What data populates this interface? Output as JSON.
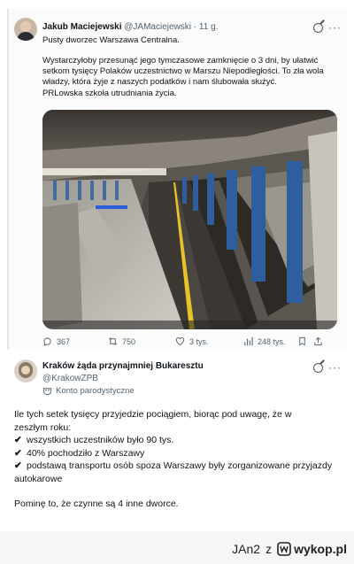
{
  "quoted_post": {
    "author_name": "Jakub Maciejewski",
    "author_handle": "@JAMaciejewski",
    "time": "· 11 g.",
    "headline": "Pusty dworzec Warszawa Centralna.",
    "body_lines": [
      "Wystarczyłoby przesunąć jego tymczasowe zamknięcie o 3 dni, by ułatwić",
      "setkom tysięcy Polaków uczestnictwo w Marszu Niepodległości. To zła wola",
      "władzy, która żyje z naszych podatków i nam ślubowała służyć.",
      "PRLowska szkoła utrudniania życia."
    ],
    "stats": {
      "replies": "367",
      "reposts": "750",
      "likes": "3 tys.",
      "views": "248 tys."
    }
  },
  "reply_post": {
    "author_name": "Kraków żąda przynajmniej Bukaresztu",
    "author_handle": "@KrakowZPB",
    "parody_label": "Konto parodystyczne",
    "intro_lines": [
      "Ile tych setek tysięcy przyjedzie pociągiem, biorąc pod uwagę, że w",
      "zeszłym roku:"
    ],
    "points": [
      "wszystkich uczestników było 90 tys.",
      "40% pochodziło z Warszawy",
      "podstawą transportu osób spoza Warszawy były zorganizowane przyjazdy autokarowe"
    ],
    "outro": "Pominę to, że czynne są 4 inne dworce."
  },
  "footer": {
    "user": "JAn2",
    "separator": "z",
    "site": "wykop.pl"
  },
  "colors": {
    "text": "#0f1419",
    "muted": "#536471",
    "platform_stripe": "#e9c22a",
    "pillar_blue": "#2f5d9e"
  }
}
